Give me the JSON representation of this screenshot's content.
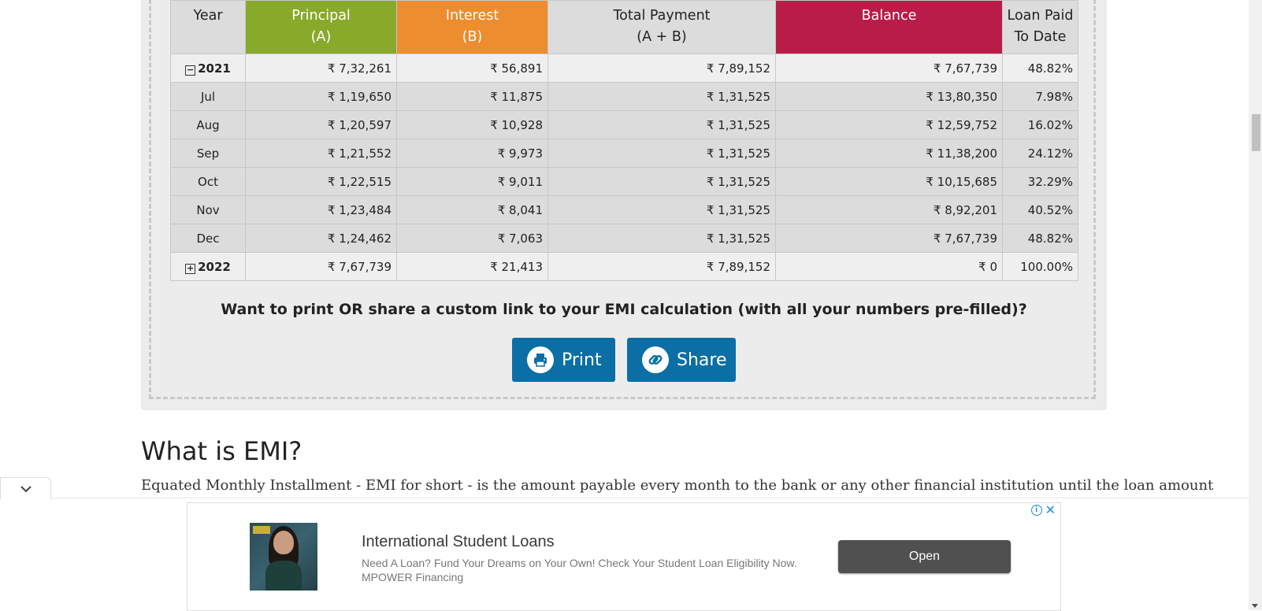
{
  "table": {
    "headers": {
      "year": "Year",
      "principal_l1": "Principal",
      "principal_l2": "(A)",
      "interest_l1": "Interest",
      "interest_l2": "(B)",
      "total_l1": "Total Payment",
      "total_l2": "(A + B)",
      "balance": "Balance",
      "paid_l1": "Loan Paid",
      "paid_l2": "To Date"
    },
    "year_2021": {
      "toggle": "−",
      "year": "2021",
      "principal": "₹ 7,32,261",
      "interest": "₹ 56,891",
      "total": "₹ 7,89,152",
      "balance": "₹ 7,67,739",
      "paid": "48.82%"
    },
    "months": [
      {
        "month": "Jul",
        "principal": "₹ 1,19,650",
        "interest": "₹ 11,875",
        "total": "₹ 1,31,525",
        "balance": "₹ 13,80,350",
        "paid": "7.98%"
      },
      {
        "month": "Aug",
        "principal": "₹ 1,20,597",
        "interest": "₹ 10,928",
        "total": "₹ 1,31,525",
        "balance": "₹ 12,59,752",
        "paid": "16.02%"
      },
      {
        "month": "Sep",
        "principal": "₹ 1,21,552",
        "interest": "₹ 9,973",
        "total": "₹ 1,31,525",
        "balance": "₹ 11,38,200",
        "paid": "24.12%"
      },
      {
        "month": "Oct",
        "principal": "₹ 1,22,515",
        "interest": "₹ 9,011",
        "total": "₹ 1,31,525",
        "balance": "₹ 10,15,685",
        "paid": "32.29%"
      },
      {
        "month": "Nov",
        "principal": "₹ 1,23,484",
        "interest": "₹ 8,041",
        "total": "₹ 1,31,525",
        "balance": "₹ 8,92,201",
        "paid": "40.52%"
      },
      {
        "month": "Dec",
        "principal": "₹ 1,24,462",
        "interest": "₹ 7,063",
        "total": "₹ 1,31,525",
        "balance": "₹ 7,67,739",
        "paid": "48.82%"
      }
    ],
    "year_2022": {
      "toggle": "+",
      "year": "2022",
      "principal": "₹ 7,67,739",
      "interest": "₹ 21,413",
      "total": "₹ 7,89,152",
      "balance": "₹ 0",
      "paid": "100.00%"
    }
  },
  "share": {
    "question": "Want to print OR share a custom link to your EMI calculation (with all your numbers pre-filled)?",
    "print_label": "Print",
    "share_label": "Share"
  },
  "article": {
    "heading": "What is EMI?",
    "text": "Equated Monthly Installment - EMI for short - is the amount payable every month to the bank or any other financial institution until the loan amount"
  },
  "ad": {
    "title": "International Student Loans",
    "description": "Need A Loan? Fund Your Dreams on Your Own! Check Your Student Loan Eligibility Now. MPOWER Financing",
    "open_label": "Open",
    "info_glyph": "i",
    "close_glyph": "✕"
  },
  "colors": {
    "principal": "#88a92a",
    "interest": "#ed8d2f",
    "balance": "#b91d47",
    "button": "#0b6fa6"
  }
}
